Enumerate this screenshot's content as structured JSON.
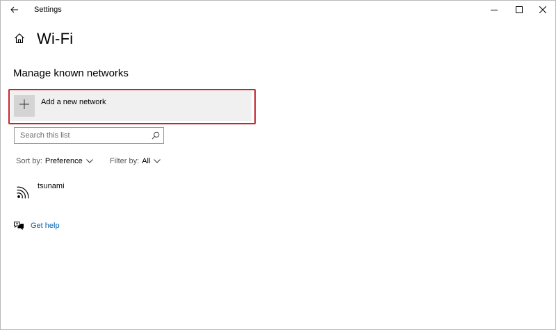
{
  "window": {
    "title": "Settings"
  },
  "page": {
    "title": "Wi-Fi",
    "section_title": "Manage known networks"
  },
  "add_network": {
    "label": "Add a new network"
  },
  "search": {
    "placeholder": "Search this list",
    "value": ""
  },
  "sort": {
    "label": "Sort by:",
    "value": "Preference"
  },
  "filter": {
    "label": "Filter by:",
    "value": "All"
  },
  "networks": [
    {
      "name": "tsunami"
    }
  ],
  "help": {
    "label": "Get help"
  },
  "colors": {
    "highlight_border": "#c4262e",
    "link": "#0063b1",
    "tile_bg": "#f0f0f0"
  },
  "icons": {
    "back": "back-arrow-icon",
    "home": "home-icon",
    "plus": "plus-icon",
    "search": "search-icon",
    "wifi": "wifi-signal-icon",
    "help": "help-chat-icon",
    "minimize": "minimize-icon",
    "maximize": "maximize-icon",
    "close": "close-icon"
  }
}
